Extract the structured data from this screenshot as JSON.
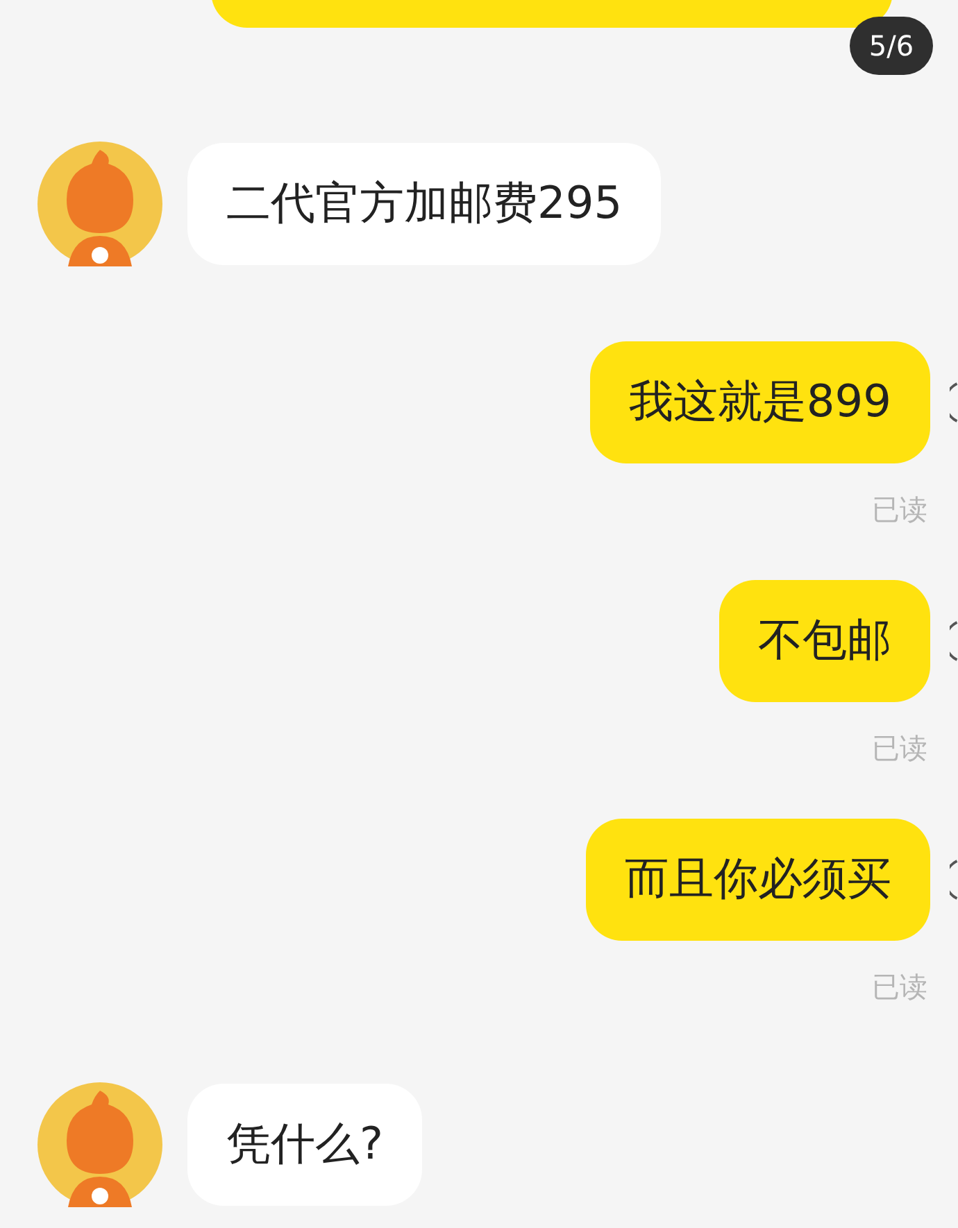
{
  "page_badge": "5/6",
  "messages": [
    {
      "kind": "sent",
      "cut": true
    },
    {
      "kind": "received",
      "text": "二代官方加邮费295"
    },
    {
      "kind": "sent",
      "text": "我这就是899",
      "status": "已读"
    },
    {
      "kind": "sent",
      "text": "不包邮",
      "status": "已读"
    },
    {
      "kind": "sent",
      "text": "而且你必须买",
      "status": "已读"
    },
    {
      "kind": "received",
      "text": "凭什么?"
    }
  ]
}
